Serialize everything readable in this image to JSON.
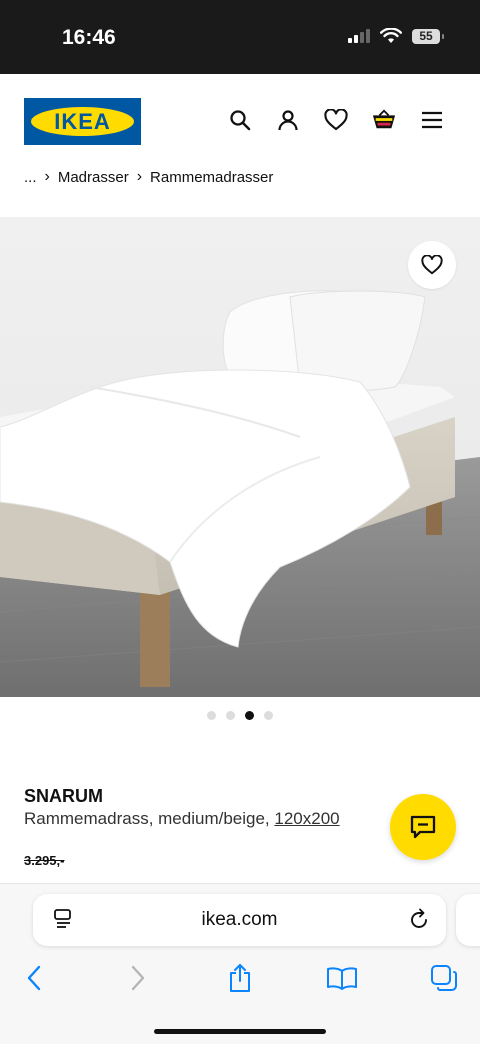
{
  "status_bar": {
    "time": "16:46",
    "battery": "55"
  },
  "header": {
    "logo_text": "IKEA",
    "icons": [
      "search-icon",
      "account-icon",
      "wishlist-icon",
      "basket-icon",
      "menu-icon"
    ]
  },
  "breadcrumb": {
    "ellipsis": "...",
    "items": [
      "Madrasser",
      "Rammemadrasser"
    ]
  },
  "gallery": {
    "dot_count": 4,
    "active_index": 2
  },
  "product": {
    "name": "SNARUM",
    "description": "Rammemadrass, medium/beige, ",
    "size": "120x200",
    "old_price": "3.295,-"
  },
  "safari": {
    "url": "ikea.com"
  },
  "colors": {
    "ikea_blue": "#0058a3",
    "ikea_yellow": "#ffdb00",
    "ios_blue": "#0a84ff"
  }
}
